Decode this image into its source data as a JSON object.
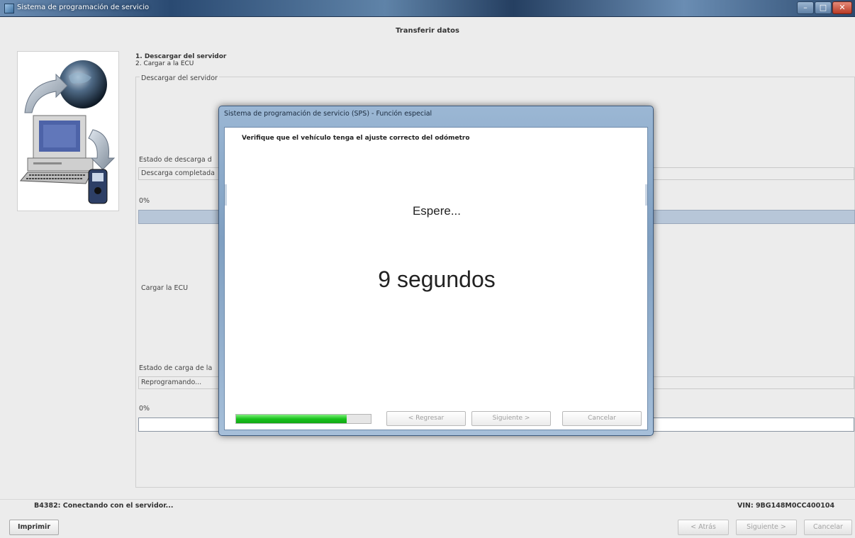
{
  "window": {
    "title": "Sistema de programación de servicio",
    "controls": [
      "minimize-icon",
      "maximize-icon",
      "close-icon"
    ]
  },
  "page": {
    "title": "Transferir datos",
    "steps": [
      "1. Descargar del servidor",
      "2. Cargar a la ECU"
    ]
  },
  "download_section": {
    "legend": "Descargar del servidor",
    "status_label": "Estado de descarga d",
    "status_value": "Descarga completada",
    "percent_label": "0%"
  },
  "upload_section": {
    "legend": "Cargar la ECU",
    "status_label": "Estado de carga de la",
    "status_value": "Reprogramando...",
    "percent_label": "0%"
  },
  "status": {
    "message": "B4382: Conectando con el servidor...",
    "vin": "VIN: 9BG148M0CC400104"
  },
  "footer_buttons": {
    "print": "Imprimir",
    "back": "< Atrás",
    "next": "Siguiente >",
    "cancel": "Cancelar"
  },
  "dialog": {
    "title": "Sistema de programación de servicio (SPS) - Función especial",
    "instruction": "Verifique que el vehículo tenga el ajuste correcto del odómetro",
    "wait_text": "Espere...",
    "countdown": "9 segundos",
    "progress": 0.82,
    "progress_color": "#19c21c",
    "buttons": {
      "back": "< Regresar",
      "next": "Siguiente >",
      "cancel": "Cancelar"
    }
  }
}
